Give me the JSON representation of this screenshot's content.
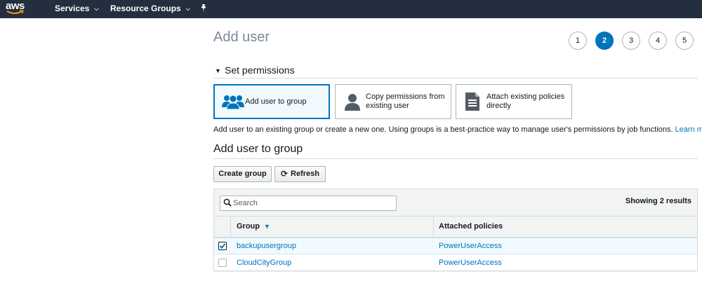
{
  "nav": {
    "logo_text": "aws",
    "services_label": "Services",
    "resource_groups_label": "Resource Groups",
    "caret": "⌄"
  },
  "page": {
    "title": "Add user",
    "steps": [
      "1",
      "2",
      "3",
      "4",
      "5"
    ],
    "active_step": "2"
  },
  "permissions": {
    "section_title": "Set permissions",
    "options": [
      {
        "label": "Add user to group",
        "icon": "users-group-icon",
        "selected": true
      },
      {
        "label": "Copy permissions from existing user",
        "icon": "user-icon",
        "selected": false
      },
      {
        "label": "Attach existing policies directly",
        "icon": "document-icon",
        "selected": false
      }
    ],
    "description": "Add user to an existing group or create a new one. Using groups is a best-practice way to manage user's permissions by job functions. ",
    "learn_more": "Learn more"
  },
  "group_section": {
    "title": "Add user to group",
    "create_button": "Create group",
    "refresh_button": "Refresh"
  },
  "table": {
    "search_placeholder": "Search",
    "showing_text": "Showing 2 results",
    "columns": [
      "Group",
      "Attached policies"
    ],
    "rows": [
      {
        "group": "backupusergroup",
        "policies": "PowerUserAccess",
        "checked": true
      },
      {
        "group": "CloudCityGroup",
        "policies": "PowerUserAccess",
        "checked": false
      }
    ]
  },
  "colors": {
    "nav_bg": "#232f3e",
    "accent": "#0073bb",
    "selected_bg": "#f1faff",
    "logo_smile": "#ff9900"
  }
}
